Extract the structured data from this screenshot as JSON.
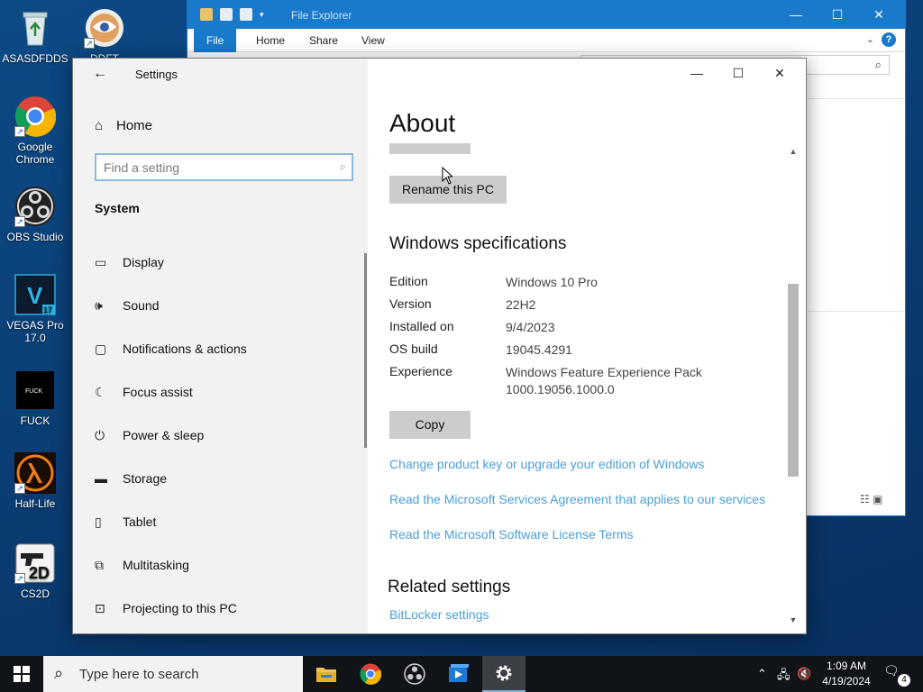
{
  "desktop": {
    "icons": [
      {
        "label": "ASASDFDDS"
      },
      {
        "label": "DDFT"
      },
      {
        "label": "Google Chrome"
      },
      {
        "label": "OBS Studio"
      },
      {
        "label": "VEGAS Pro 17.0"
      },
      {
        "label": "FUCK"
      },
      {
        "label": "Half-Life"
      },
      {
        "label": "CS2D"
      }
    ],
    "fuck_icon_text": "FUCK",
    "vegas_icon_letter": "V",
    "vegas_icon_version": "17",
    "cs2d_icon_text": "2D"
  },
  "explorer": {
    "title": "File Explorer",
    "tabs": [
      "File",
      "Home",
      "Share",
      "View"
    ],
    "help": "?"
  },
  "settings": {
    "app_title": "Settings",
    "home_label": "Home",
    "search_placeholder": "Find a setting",
    "section": "System",
    "nav_items": [
      {
        "label": "Display",
        "icon": "display-icon"
      },
      {
        "label": "Sound",
        "icon": "speaker-icon"
      },
      {
        "label": "Notifications & actions",
        "icon": "notification-icon"
      },
      {
        "label": "Focus assist",
        "icon": "moon-icon"
      },
      {
        "label": "Power & sleep",
        "icon": "power-icon"
      },
      {
        "label": "Storage",
        "icon": "storage-icon"
      },
      {
        "label": "Tablet",
        "icon": "tablet-icon"
      },
      {
        "label": "Multitasking",
        "icon": "multitasking-icon"
      },
      {
        "label": "Projecting to this PC",
        "icon": "projecting-icon"
      }
    ],
    "page_title": "About",
    "rename_button": "Rename this PC",
    "specs_title": "Windows specifications",
    "specs": [
      {
        "key": "Edition",
        "value": "Windows 10 Pro"
      },
      {
        "key": "Version",
        "value": "22H2"
      },
      {
        "key": "Installed on",
        "value": "9/4/2023"
      },
      {
        "key": "OS build",
        "value": "19045.4291"
      },
      {
        "key": "Experience",
        "value": "Windows Feature Experience Pack 1000.19056.1000.0"
      }
    ],
    "copy_button": "Copy",
    "links": [
      "Change product key or upgrade your edition of Windows",
      "Read the Microsoft Services Agreement that applies to our services",
      "Read the Microsoft Software License Terms"
    ],
    "related_title": "Related settings",
    "related_link": "BitLocker settings"
  },
  "taskbar": {
    "search_placeholder": "Type here to search",
    "time": "1:09 AM",
    "date": "4/19/2024",
    "notification_count": "4"
  },
  "colors": {
    "accent": "#1979ca",
    "link": "#4a9fd8",
    "nav_bg": "#f2f2f2",
    "taskbar": "#101418"
  }
}
